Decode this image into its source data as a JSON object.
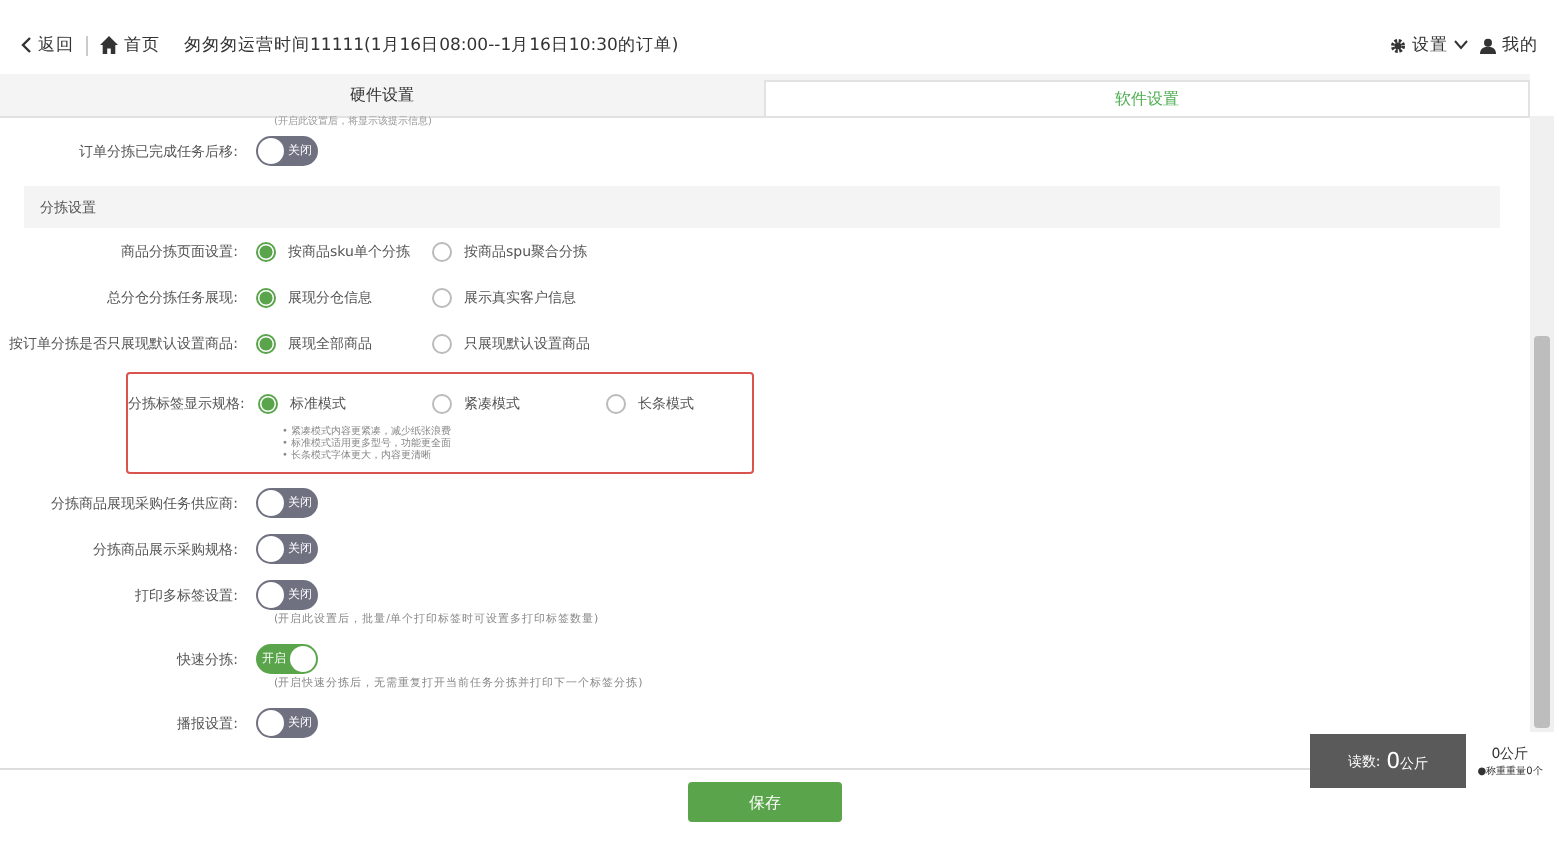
{
  "header": {
    "back": "返回",
    "home": "首页",
    "title": "匆匆匆运营时间11111(1月16日08:00--1月16日10:30的订单)",
    "settings": "设置",
    "me": "我的"
  },
  "tabs": [
    {
      "label": "硬件设置",
      "selected": false
    },
    {
      "label": "软件设置",
      "selected": true
    }
  ],
  "top_hint": "(开启此设置后，将显示该提示信息)",
  "top_rows": [
    {
      "kind": "toggle",
      "label": "订单分拣已完成任务后移:",
      "on": false,
      "text": "关闭"
    }
  ],
  "section": "分拣设置",
  "rows": [
    {
      "kind": "radio",
      "label": "商品分拣页面设置:",
      "options": [
        {
          "label": "按商品sku单个分拣",
          "selected": true
        },
        {
          "label": "按商品spu聚合分拣",
          "selected": false
        }
      ]
    },
    {
      "kind": "radio",
      "label": "总分仓分拣任务展现:",
      "options": [
        {
          "label": "展现分仓信息",
          "selected": true
        },
        {
          "label": "展示真实客户信息",
          "selected": false
        }
      ]
    },
    {
      "kind": "radio",
      "label": "按订单分拣是否只展现默认设置商品:",
      "options": [
        {
          "label": "展现全部商品",
          "selected": true
        },
        {
          "label": "只展现默认设置商品",
          "selected": false
        }
      ]
    },
    {
      "kind": "radio",
      "label": "分拣标签显示规格:",
      "highlighted": true,
      "options": [
        {
          "label": "标准模式",
          "selected": true
        },
        {
          "label": "紧凑模式",
          "selected": false
        },
        {
          "label": "长条模式",
          "selected": false
        }
      ],
      "notes": [
        "• 紧凑模式内容更紧凑，减少纸张浪费",
        "• 标准模式适用更多型号，功能更全面",
        "• 长条模式字体更大，内容更清晰"
      ]
    },
    {
      "kind": "toggle",
      "label": "分拣商品展现采购任务供应商:",
      "on": false,
      "text": "关闭"
    },
    {
      "kind": "toggle",
      "label": "分拣商品展示采购规格:",
      "on": false,
      "text": "关闭"
    },
    {
      "kind": "toggle",
      "label": "打印多标签设置:",
      "on": false,
      "text": "关闭",
      "hint": "(开启此设置后，批量/单个打印标签时可设置多打印标签数量)"
    },
    {
      "kind": "toggle",
      "label": "快速分拣:",
      "on": true,
      "text": "开启",
      "hint": "(开启快速分拣后，无需重复打开当前任务分拣并打印下一个标签分拣)"
    },
    {
      "kind": "toggle",
      "label": "播报设置:",
      "on": false,
      "text": "关闭"
    }
  ],
  "save": "保存",
  "scale": {
    "reading_label": "读数:",
    "reading_value": "0",
    "reading_unit": "公斤",
    "weight": "0公斤",
    "count": "●称重重量0个"
  }
}
